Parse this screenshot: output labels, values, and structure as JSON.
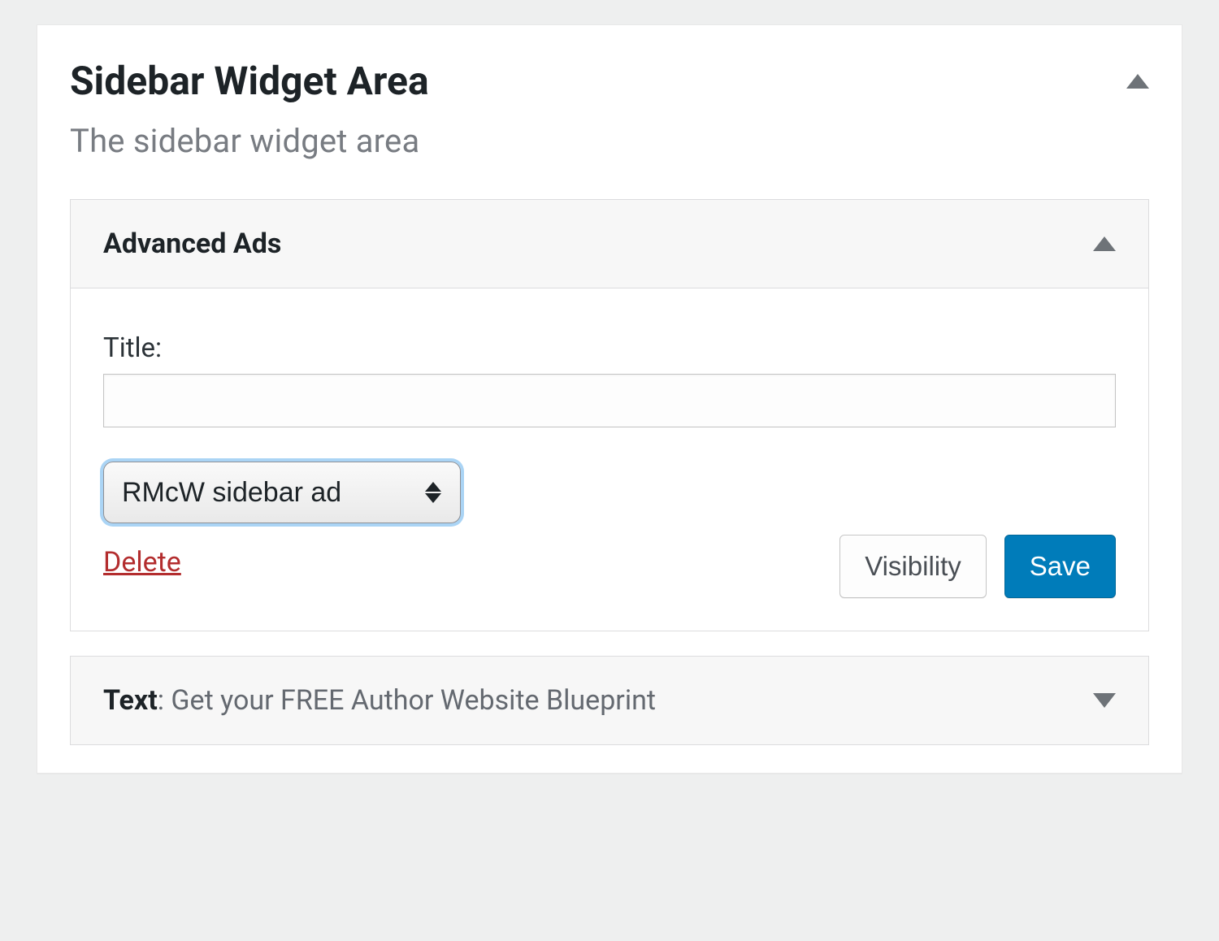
{
  "panel": {
    "title": "Sidebar Widget Area",
    "subtitle": "The sidebar widget area"
  },
  "widget_open": {
    "title": "Advanced Ads",
    "title_label": "Title:",
    "title_value": "",
    "selected_ad": "RMcW sidebar ad",
    "delete_label": "Delete",
    "visibility_label": "Visibility",
    "save_label": "Save"
  },
  "widget_collapsed": {
    "type_label": "Text",
    "separator": ": ",
    "title": "Get your FREE Author Website Blueprint"
  }
}
